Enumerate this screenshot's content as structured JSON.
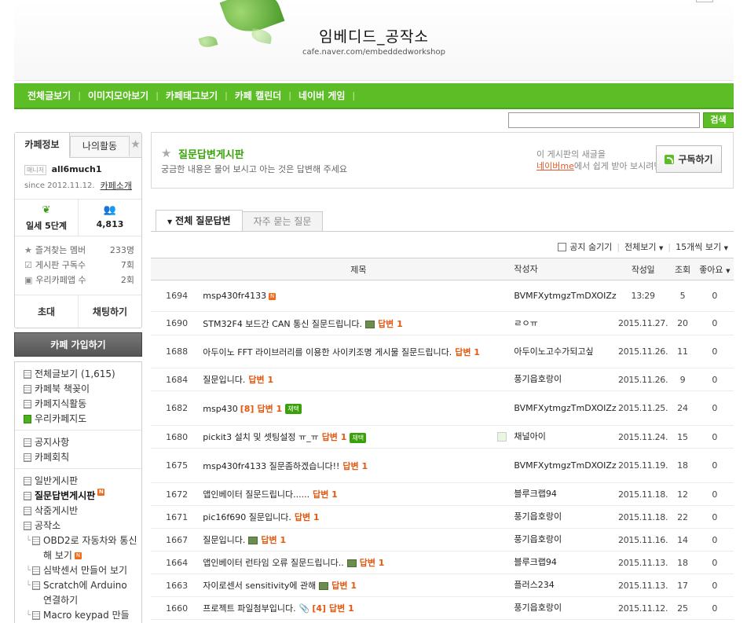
{
  "header": {
    "title": "임베디드_공작소",
    "url": "cafe.naver.com/embeddedworkshop"
  },
  "gnav": {
    "items": [
      "전체글보기",
      "이미지모아보기",
      "카페태그보기",
      "카페 캘린더",
      "네이버 게임"
    ]
  },
  "search": {
    "placeholder": "",
    "button": "검색"
  },
  "sidebar": {
    "tab_info": "카페정보",
    "tab_activity": "나의활동",
    "manager_badge": "매니저",
    "manager": "all6much1",
    "since": "since 2012.11.12.",
    "intro_link": "카페소개",
    "level": "일세 5단계",
    "members": "4,813",
    "stats": [
      {
        "label": "즐겨찾는 멤버",
        "value": "233명"
      },
      {
        "label": "게시판 구독수",
        "value": "7회"
      },
      {
        "label": "우리카페앱 수",
        "value": "2회"
      }
    ],
    "invite": "초대",
    "chat": "채팅하기",
    "join": "카페 가입하기",
    "menu_group1": [
      "전체글보기 (1,615)",
      "카페북 책꽂이",
      "카페지식활동",
      "우리카페지도"
    ],
    "menu_group2": [
      "공지사항",
      "카페회칙"
    ],
    "menu_group3": [
      "일반게시판",
      "질문답변게시판",
      "삭줌게시반",
      "공작소"
    ],
    "menu_sub": [
      "OBD2로 자동차와 통신해 보기",
      "심박센서 만들어 보기",
      "Scratch에 Arduino 연결하기",
      "Macro keypad 만들기"
    ]
  },
  "board": {
    "title": "질문답변게시판",
    "desc": "궁금한 내용은 물어 보시고 아는 것은 답변해 주세요",
    "note1": "이 게시판의 새글을",
    "note2_link": "네이버me",
    "note2_rest": "에서 쉽게 받아 보시려면",
    "subscribe": "구독하기",
    "tab_all": "전체 질문답변",
    "tab_faq": "자주 묻는 질문",
    "hide_notice": "공지 숨기기",
    "view_all": "전체보기",
    "per_page": "15개씩 보기"
  },
  "table": {
    "headers": [
      "제목",
      "작성자",
      "작성일",
      "조회",
      "좋아요"
    ],
    "rows": [
      {
        "num": "1694",
        "title": "msp430fr4133",
        "new": true,
        "author": "BVMFXytmgzTmDXOIZz",
        "date": "13:29",
        "views": "5",
        "likes": "0"
      },
      {
        "num": "1690",
        "title": "STM32F4 보드간 CAN 통신 질문드립니다.",
        "pic": true,
        "reply": "답변 1",
        "author": "ㄹㅇㅠ",
        "date": "2015.11.27.",
        "views": "20",
        "likes": "0"
      },
      {
        "num": "1688",
        "title": "아두이노 FFT 라이브러리를 이용한 사이키조명 게시물 질문드립니다.",
        "reply": "답변 1",
        "author": "아두이노고수가되고싶",
        "date": "2015.11.26.",
        "views": "11",
        "likes": "0"
      },
      {
        "num": "1684",
        "title": "질문입니다.",
        "reply": "답변 1",
        "author": "풍기읍호랑이",
        "date": "2015.11.26.",
        "views": "9",
        "likes": "0"
      },
      {
        "num": "1682",
        "title": "msp430",
        "count": "[8]",
        "reply": "답변 1",
        "chosen": "채택",
        "author": "BVMFXytmgzTmDXOIZz",
        "date": "2015.11.25.",
        "views": "24",
        "likes": "0"
      },
      {
        "num": "1680",
        "title": "pickit3 설치 및 셋팅설정 ㅠ_ㅠ",
        "reply": "답변 1",
        "chosen": "채택",
        "leaf": true,
        "author": "채널아이",
        "date": "2015.11.24.",
        "views": "15",
        "likes": "0"
      },
      {
        "num": "1675",
        "title": "msp430fr4133 질문좀하겠습니다!!",
        "reply": "답변 1",
        "author": "BVMFXytmgzTmDXOIZz",
        "date": "2015.11.19.",
        "views": "18",
        "likes": "0"
      },
      {
        "num": "1672",
        "title": "앱인베이터 질문드립니다......",
        "reply": "답변 1",
        "author": "블루크랩94",
        "date": "2015.11.18.",
        "views": "12",
        "likes": "0"
      },
      {
        "num": "1671",
        "title": "pic16f690 질문입니다.",
        "reply": "답변 1",
        "author": "풍기읍호랑이",
        "date": "2015.11.18.",
        "views": "22",
        "likes": "0"
      },
      {
        "num": "1667",
        "title": "질문입니다.",
        "pic": true,
        "reply": "답변 1",
        "author": "풍기읍호랑이",
        "date": "2015.11.16.",
        "views": "14",
        "likes": "0"
      },
      {
        "num": "1664",
        "title": "앱인베이터 런타임 오류 질문드립니다..",
        "pic": true,
        "reply": "답변 1",
        "author": "블루크랩94",
        "date": "2015.11.13.",
        "views": "18",
        "likes": "0"
      },
      {
        "num": "1663",
        "title": "자이로센서 sensitivity에 관해",
        "pic": true,
        "reply": "답변 1",
        "author": "플러스234",
        "date": "2015.11.13.",
        "views": "17",
        "likes": "0"
      },
      {
        "num": "1660",
        "title": "프로젝트 파일첨부입니다.",
        "clip": true,
        "count": "[4]",
        "reply": "답변 1",
        "author": "풍기읍호랑이",
        "date": "2015.11.12.",
        "views": "25",
        "likes": "0"
      }
    ]
  }
}
